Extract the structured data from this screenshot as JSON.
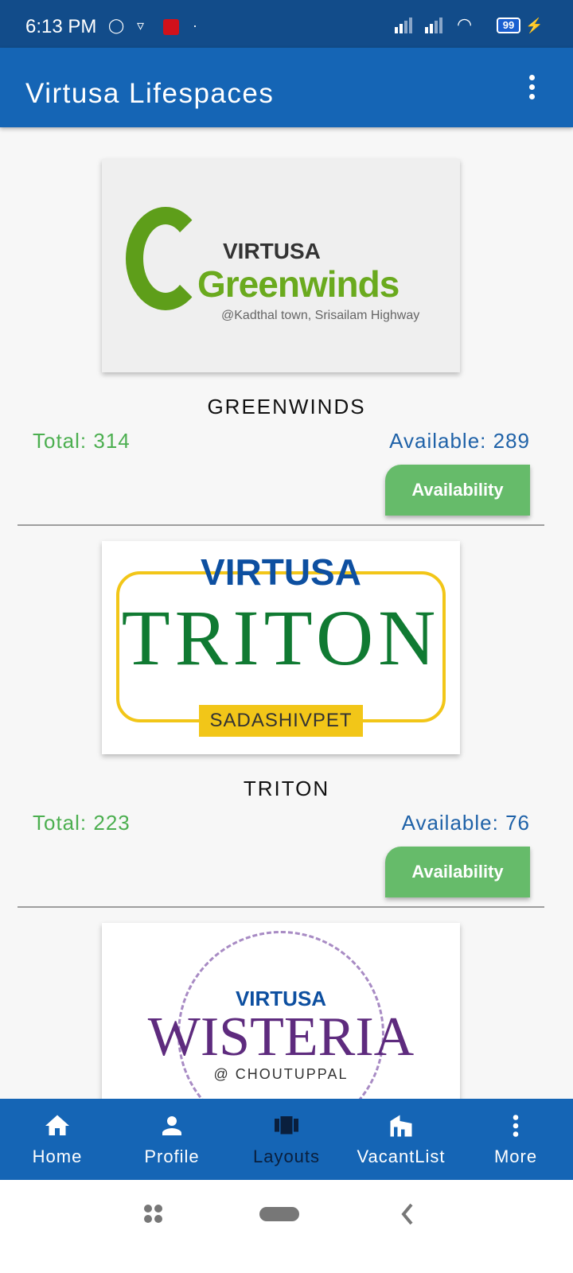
{
  "status_bar": {
    "time": "6:13 PM",
    "battery": "99",
    "carrier_icon": "airtel-icon"
  },
  "app_bar": {
    "title": "Virtusa Lifespaces",
    "menu_icon": "more-vert-icon"
  },
  "projects": [
    {
      "name": "GREENWINDS",
      "total": "Total: 314",
      "available": "Available: 289",
      "button": "Availability",
      "logo": {
        "brand": "VIRTUSA",
        "title": "Greenwinds",
        "subtitle": "@Kadthal town, Srisailam Highway"
      }
    },
    {
      "name": "TRITON",
      "total": "Total: 223",
      "available": "Available: 76",
      "button": "Availability",
      "logo": {
        "brand": "VIRTUSA",
        "title": "TRITON",
        "subtitle": "SADASHIVPET"
      }
    },
    {
      "logo": {
        "brand": "VIRTUSA",
        "title": "WISTERIA",
        "subtitle": "@ CHOUTUPPAL"
      }
    }
  ],
  "bottom_nav": [
    {
      "label": "Home",
      "icon": "home-icon"
    },
    {
      "label": "Profile",
      "icon": "person-icon"
    },
    {
      "label": "Layouts",
      "icon": "carousel-icon",
      "active": true
    },
    {
      "label": "VacantList",
      "icon": "buildings-icon"
    },
    {
      "label": "More",
      "icon": "more-vert-icon"
    }
  ],
  "colors": {
    "primary": "#1565b5",
    "status_bar": "#124c8a",
    "total": "#4caf50",
    "available": "#1f62a8",
    "button": "#66bb6a"
  }
}
